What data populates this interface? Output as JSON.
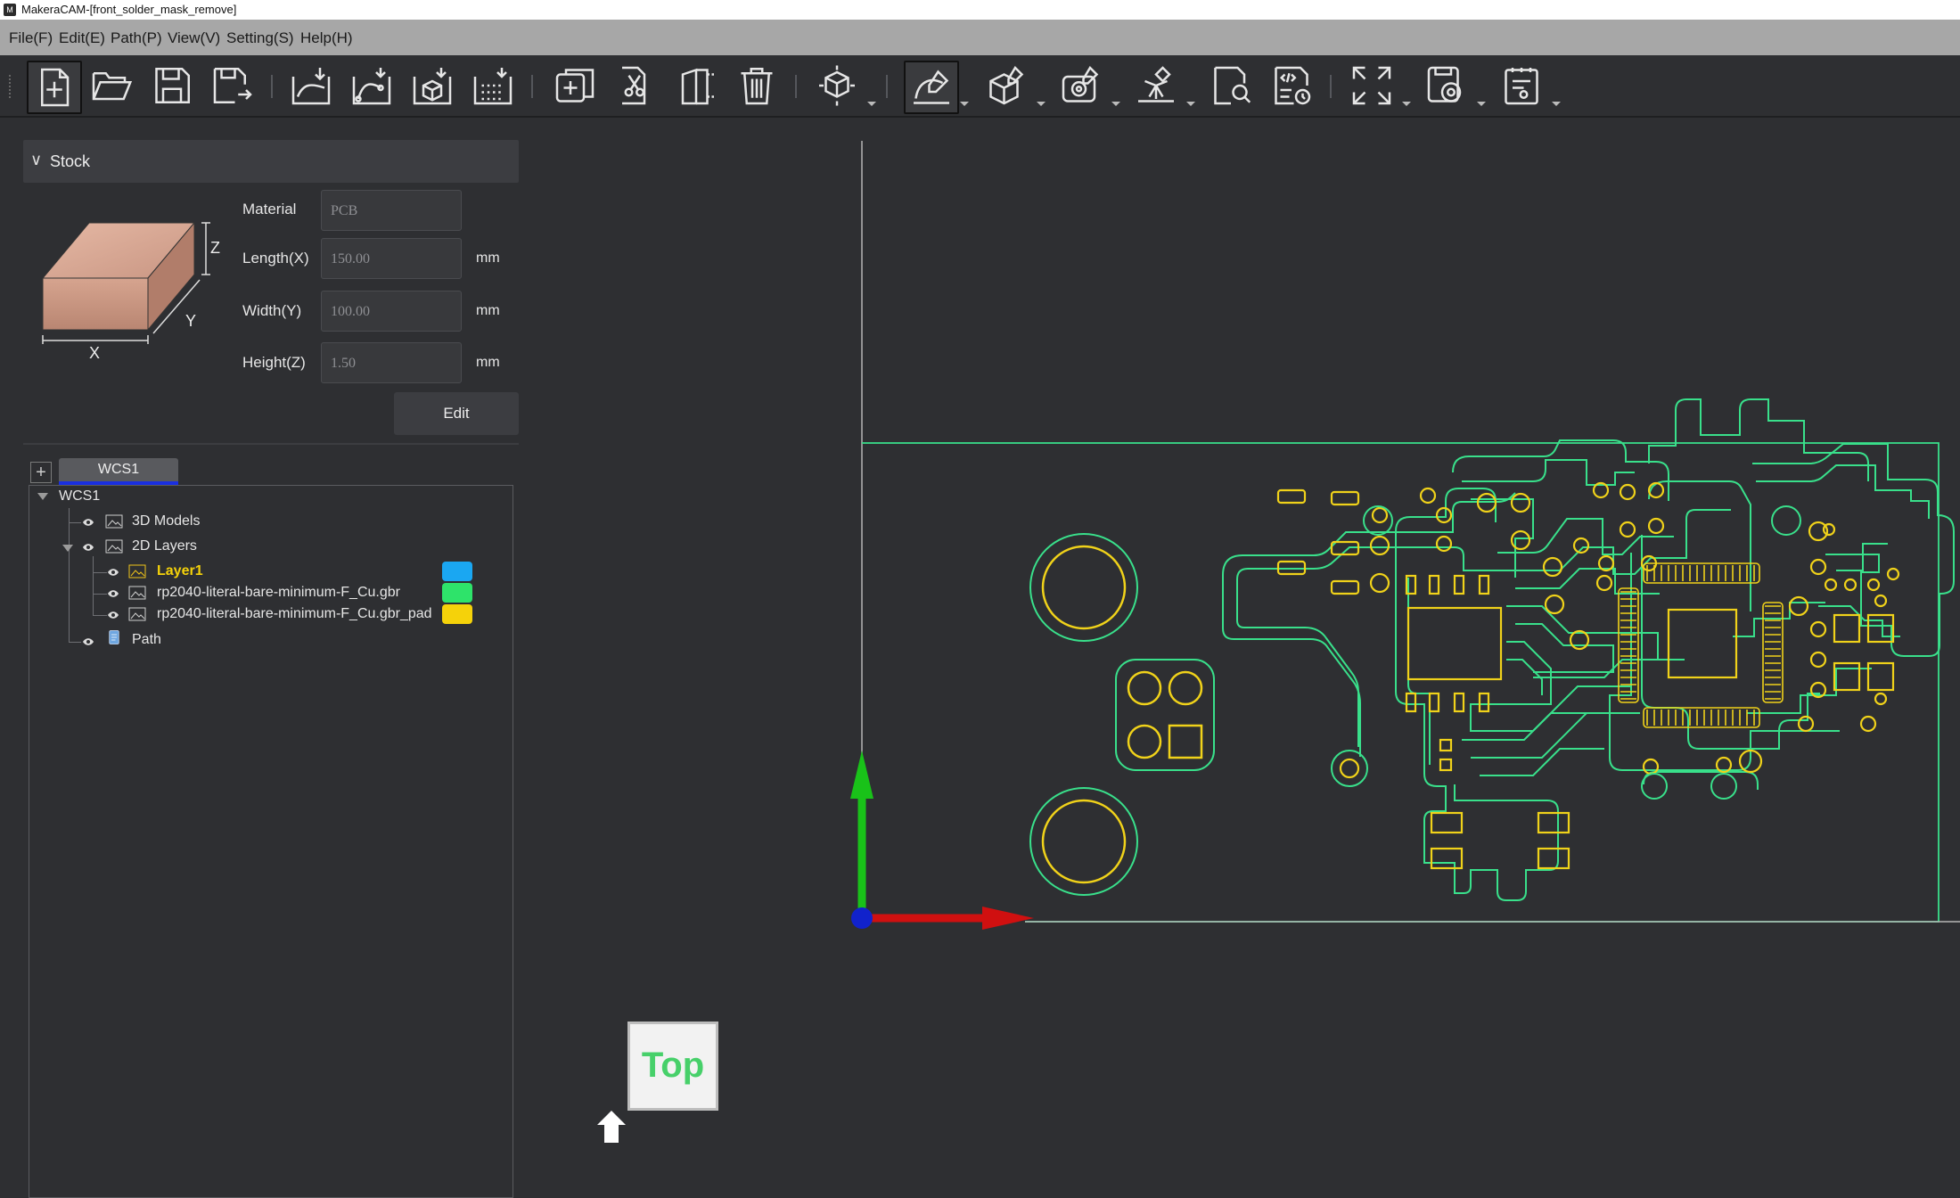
{
  "window": {
    "title": "MakeraCAM-[front_solder_mask_remove]",
    "app_icon": "M"
  },
  "menu": [
    {
      "label": "File(F)"
    },
    {
      "label": "Edit(E)"
    },
    {
      "label": "Path(P)"
    },
    {
      "label": "View(V)"
    },
    {
      "label": "Setting(S)"
    },
    {
      "label": "Help(H)"
    }
  ],
  "toolbar": {
    "icons": [
      "new-file-icon",
      "open-folder-icon",
      "save-icon",
      "save-as-icon",
      "import-2d-icon",
      "import-vector-icon",
      "import-3d-icon",
      "import-pointcloud-icon",
      "add-layer-icon",
      "cut-icon",
      "stock-icon",
      "delete-icon",
      "view-cube-icon",
      "2d-path-icon",
      "3d-path-icon",
      "4axis-path-icon",
      "laser-path-icon",
      "simulate-icon",
      "gcode-icon",
      "fullscreen-icon",
      "machine-icon",
      "report-icon"
    ]
  },
  "stock": {
    "header": "Stock",
    "material_label": "Material",
    "material_value": "PCB",
    "length_label": "Length(X)",
    "length_value": "150.00",
    "width_label": "Width(Y)",
    "width_value": "100.00",
    "height_label": "Height(Z)",
    "height_value": "1.50",
    "unit": "mm",
    "edit_label": "Edit",
    "axis_x": "X",
    "axis_y": "Y",
    "axis_z": "Z"
  },
  "wcs": {
    "add_label": "+",
    "tab_label": "WCS1"
  },
  "tree": {
    "root": "WCS1",
    "models": "3D Models",
    "layers": "2D Layers",
    "layer1": "Layer1",
    "file1": "rp2040-literal-bare-minimum-F_Cu.gbr",
    "file2": "rp2040-literal-bare-minimum-F_Cu.gbr_pad",
    "path": "Path",
    "colors": {
      "layer1": "#1aa7f2",
      "file1": "#2ee36a",
      "file2": "#f5d20a"
    }
  },
  "viewport": {
    "view_label": "Top",
    "colors": {
      "outline": "#39e08b",
      "pads": "#f0d21a",
      "x_axis": "#d01010",
      "y_axis": "#19c219",
      "origin": "#1122cc"
    }
  }
}
